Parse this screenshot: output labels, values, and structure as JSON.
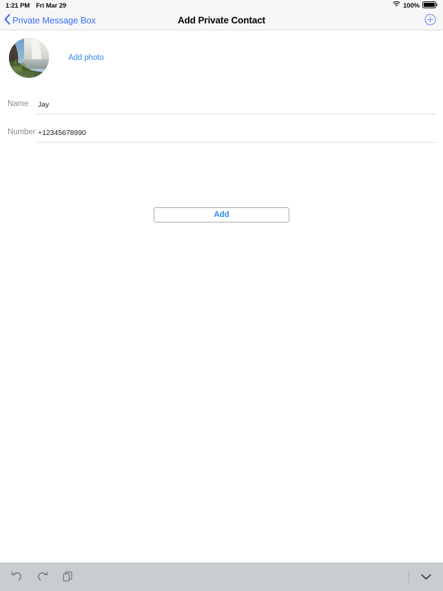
{
  "status_bar": {
    "time": "1:21 PM",
    "date": "Fri Mar 29",
    "battery_percent": "100%",
    "wifi_icon": "wifi-icon",
    "battery_icon": "battery-full-icon"
  },
  "nav_bar": {
    "back_label": "Private Message Box",
    "back_icon": "chevron-left-icon",
    "title": "Add Private Contact",
    "add_icon": "plus-circle-icon"
  },
  "photo_section": {
    "avatar_alt": "contact-photo-waterfall-landscape",
    "add_photo_label": "Add photo"
  },
  "form": {
    "fields": [
      {
        "label": "Name",
        "value": "Jay",
        "placeholder": ""
      },
      {
        "label": "Number",
        "value": "+12345678990",
        "placeholder": ""
      }
    ]
  },
  "actions": {
    "add_button_label": "Add"
  },
  "keyboard_toolbar": {
    "undo_icon": "undo-icon",
    "redo_icon": "redo-icon",
    "paste_icon": "paste-icon",
    "dismiss_icon": "chevron-down-icon"
  },
  "colors": {
    "ios_blue": "#2e8bf0",
    "nav_blue": "#3b6ef5",
    "label_gray": "#8d8d92",
    "toolbar_bg": "#c9ccd1"
  }
}
